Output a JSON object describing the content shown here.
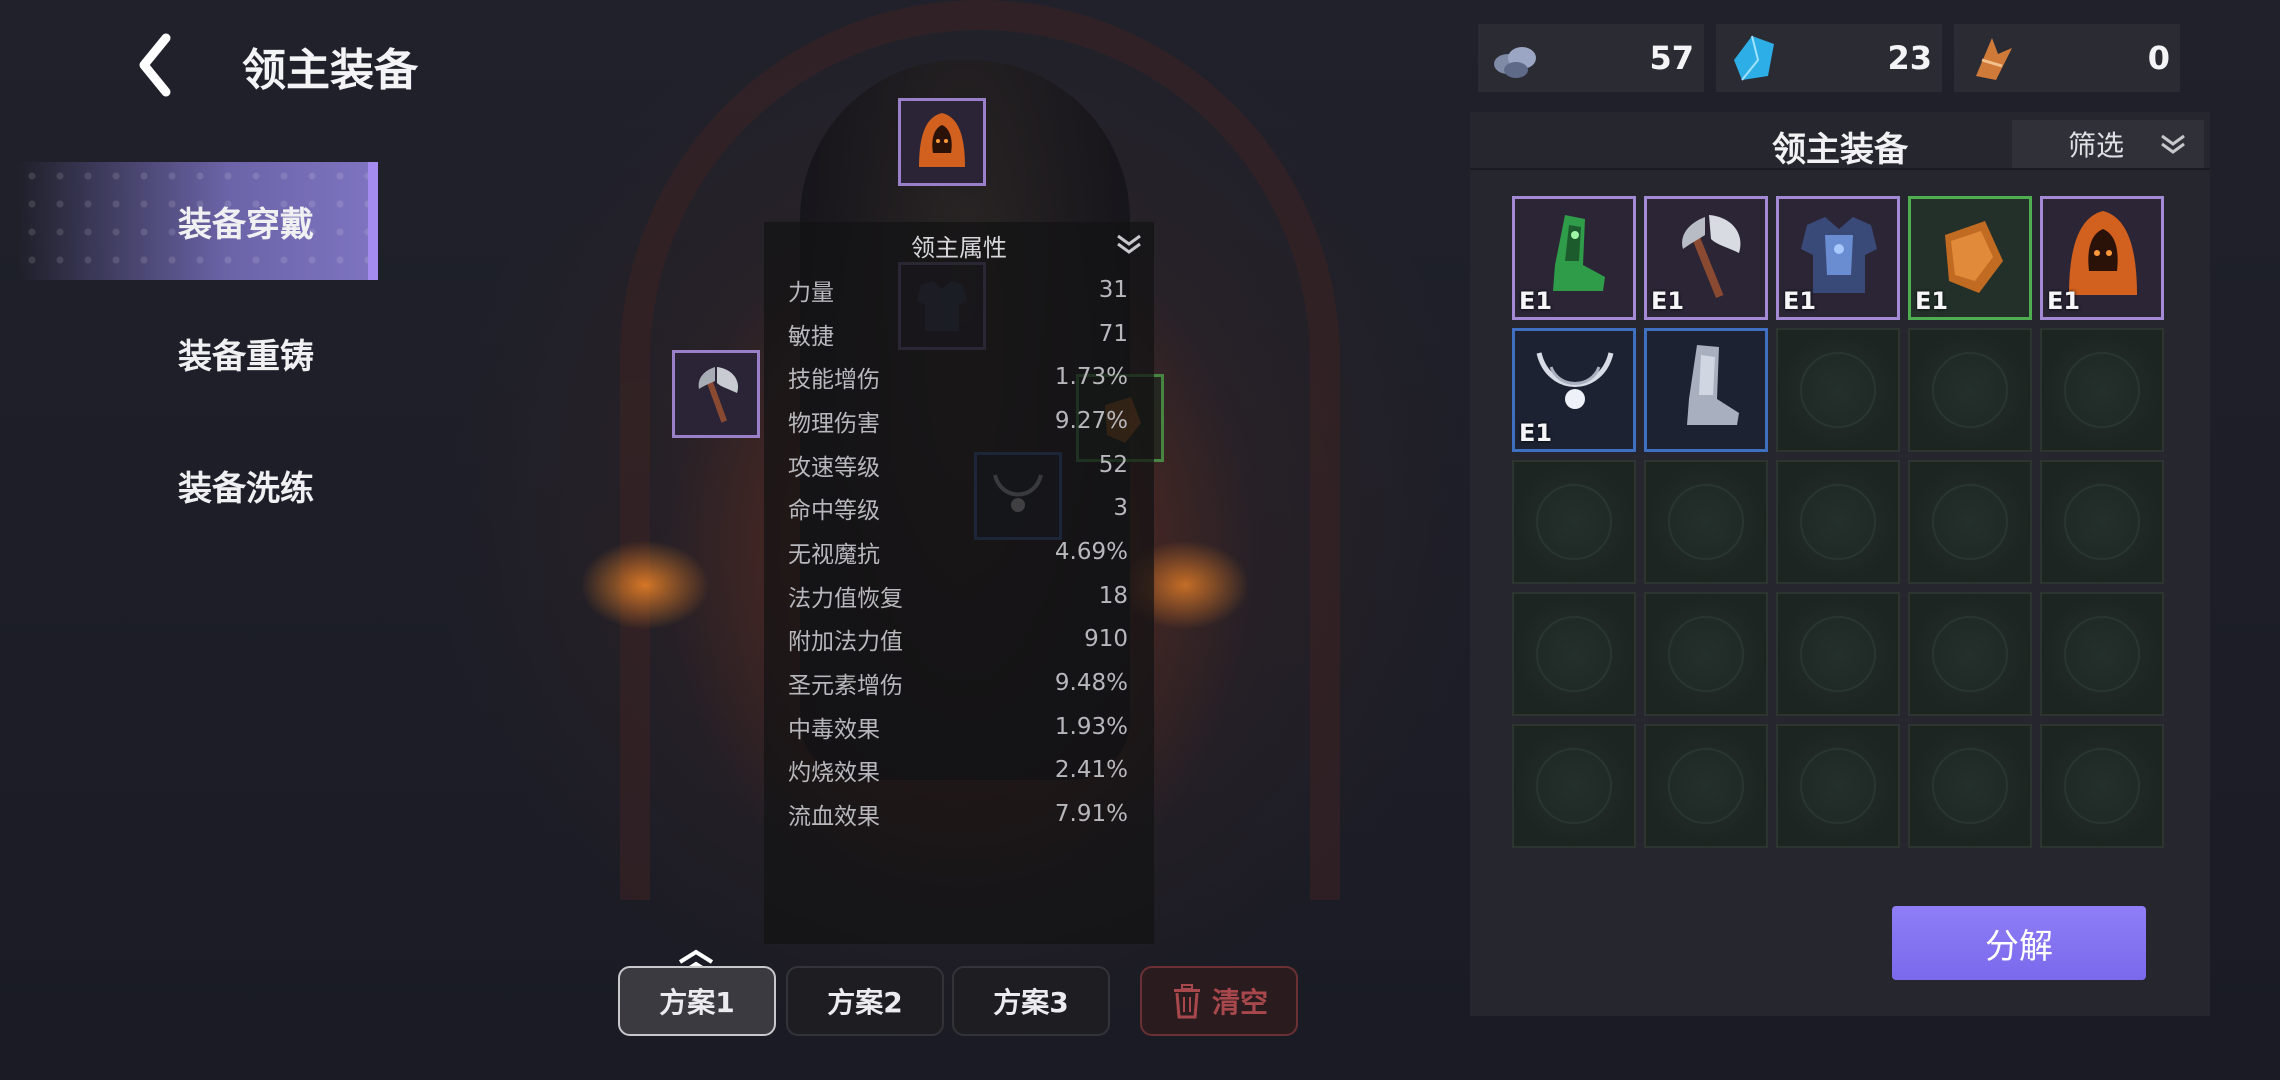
{
  "header": {
    "title": "领主装备"
  },
  "nav": {
    "items": [
      {
        "label": "装备穿戴",
        "active": true
      },
      {
        "label": "装备重铸",
        "active": false
      },
      {
        "label": "装备洗练",
        "active": false
      }
    ]
  },
  "currencies": [
    {
      "icon": "ore-icon",
      "value": "57"
    },
    {
      "icon": "crystal-icon",
      "value": "23"
    },
    {
      "icon": "shard-icon",
      "value": "0"
    }
  ],
  "attributes": {
    "title": "领主属性",
    "rows": [
      {
        "name": "力量",
        "value": "31"
      },
      {
        "name": "敏捷",
        "value": "71"
      },
      {
        "name": "技能增伤",
        "value": "1.73%"
      },
      {
        "name": "物理伤害",
        "value": "9.27%"
      },
      {
        "name": "攻速等级",
        "value": "52"
      },
      {
        "name": "命中等级",
        "value": "3"
      },
      {
        "name": "无视魔抗",
        "value": "4.69%"
      },
      {
        "name": "法力值恢复",
        "value": "18"
      },
      {
        "name": "附加法力值",
        "value": "910"
      },
      {
        "name": "圣元素增伤",
        "value": "9.48%"
      },
      {
        "name": "中毒效果",
        "value": "1.93%"
      },
      {
        "name": "灼烧效果",
        "value": "2.41%"
      },
      {
        "name": "流血效果",
        "value": "7.91%"
      }
    ]
  },
  "schemes": {
    "plan1": "方案1",
    "plan2": "方案2",
    "plan3": "方案3",
    "clear": "清空"
  },
  "inventory": {
    "title": "领主装备",
    "filter_label": "筛选",
    "items": [
      {
        "icon": "boots-green-icon",
        "rarity": "purple",
        "tier": "E1"
      },
      {
        "icon": "axe-icon",
        "rarity": "purple",
        "tier": "E1"
      },
      {
        "icon": "chest-armor-icon",
        "rarity": "purple",
        "tier": "E1"
      },
      {
        "icon": "gloves-icon",
        "rarity": "green",
        "tier": "E1"
      },
      {
        "icon": "hood-icon",
        "rarity": "purple",
        "tier": "E1"
      },
      {
        "icon": "necklace-icon",
        "rarity": "blue",
        "tier": "E1"
      },
      {
        "icon": "greaves-icon",
        "rarity": "blue",
        "tier": ""
      }
    ],
    "empty_slots": 18
  },
  "dismantle_label": "分解",
  "colors": {
    "accent": "#8e7ef6",
    "nav_active": "#a48bf0",
    "purple_rarity": "#a48ad4",
    "green_rarity": "#4fae4f",
    "blue_rarity": "#3f6fc0",
    "danger": "#a8484c"
  }
}
